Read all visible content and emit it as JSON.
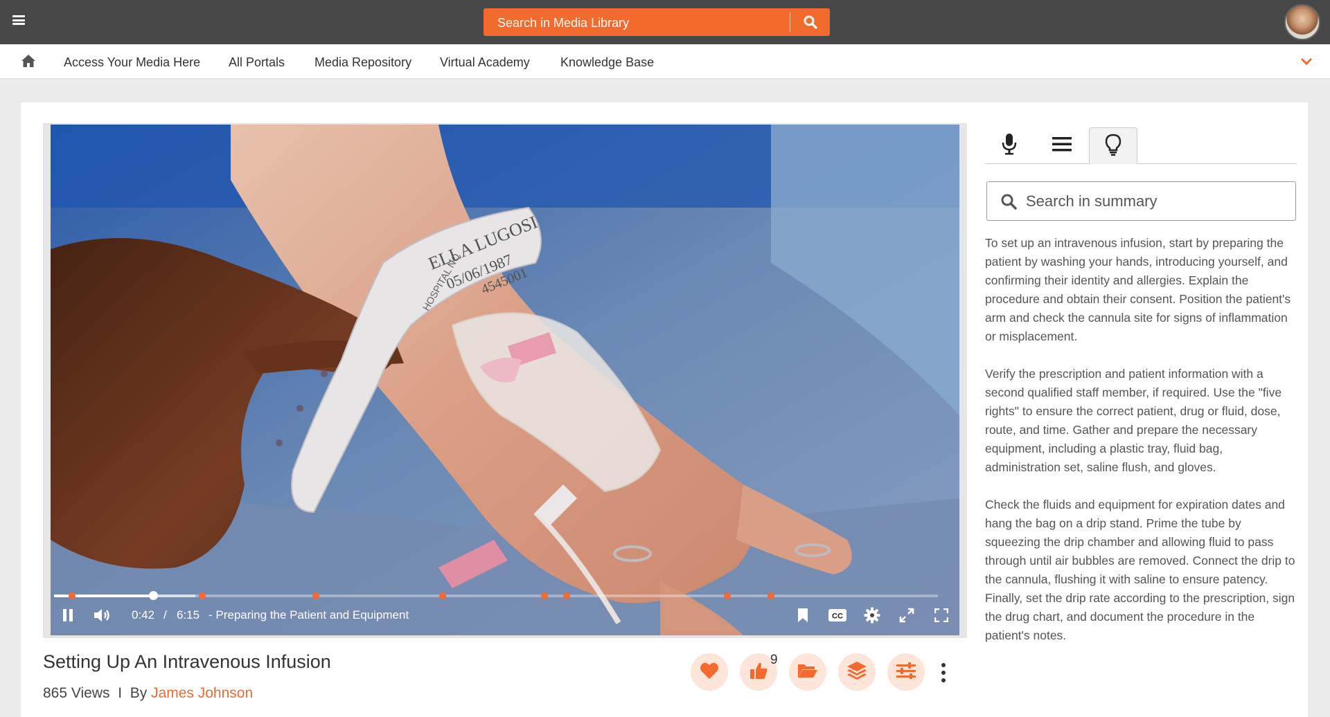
{
  "colors": {
    "accent": "#f26a2e",
    "topbar": "#474747",
    "accent_light": "#fde5d9"
  },
  "header": {
    "menu_icon": "hamburger-icon",
    "search_placeholder": "Search in Media Library",
    "search_icon": "search-icon",
    "avatar_icon": "user-avatar"
  },
  "nav": {
    "home_icon": "home-icon",
    "items": [
      {
        "label": "Access Your Media Here"
      },
      {
        "label": "All Portals"
      },
      {
        "label": "Media Repository"
      },
      {
        "label": "Virtual Academy"
      },
      {
        "label": "Knowledge Base"
      }
    ],
    "expand_icon": "chevron-down-icon"
  },
  "player": {
    "current_time": "0:42",
    "separator": "/",
    "duration": "6:15",
    "chapter_title": "- Preparing the Patient and Equipment",
    "played_fraction": 0.112,
    "buffered_fraction": 0.16,
    "chapter_markers_fraction": [
      0.02,
      0.168,
      0.296,
      0.44,
      0.555,
      0.58,
      0.762,
      0.811
    ],
    "wristband_text": [
      "ELLA LUGOSI",
      "05/06/1987",
      "4545001",
      "HOSPITAL NO"
    ],
    "controls": [
      "pause-icon",
      "volume-icon",
      "bookmark-icon",
      "captions-icon",
      "settings-icon",
      "expand-icon",
      "fullscreen-icon"
    ],
    "cc_label": "CC"
  },
  "video_info": {
    "title": "Setting Up An Intravenous Infusion",
    "views": "865 Views",
    "by_separator": "I",
    "by_label": "By",
    "author": "James Johnson",
    "like_count": "9",
    "actions": [
      "heart-icon",
      "thumbs-up-icon",
      "folder-icon",
      "layers-icon",
      "sliders-icon",
      "more-vertical-icon"
    ]
  },
  "side_panel": {
    "tabs": [
      {
        "icon": "microphone-icon",
        "active": false
      },
      {
        "icon": "list-icon",
        "active": false
      },
      {
        "icon": "lightbulb-icon",
        "active": true
      }
    ],
    "search_placeholder": "Search in summary",
    "summary_paragraphs": [
      "To set up an intravenous infusion, start by preparing the patient by washing your hands, introducing yourself, and confirming their identity and allergies. Explain the procedure and obtain their consent. Position the patient's arm and check the cannula site for signs of inflammation or misplacement.",
      "Verify the prescription and patient information with a second qualified staff member, if required. Use the \"five rights\" to ensure the correct patient, drug or fluid, dose, route, and time. Gather and prepare the necessary equipment, including a plastic tray, fluid bag, administration set, saline flush, and gloves.",
      "Check the fluids and equipment for expiration dates and hang the bag on a drip stand. Prime the tube by squeezing the drip chamber and allowing fluid to pass through until air bubbles are removed. Connect the drip to the cannula, flushing it with saline to ensure patency. Finally, set the drip rate according to the prescription, sign the drug chart, and document the procedure in the patient's notes."
    ]
  }
}
